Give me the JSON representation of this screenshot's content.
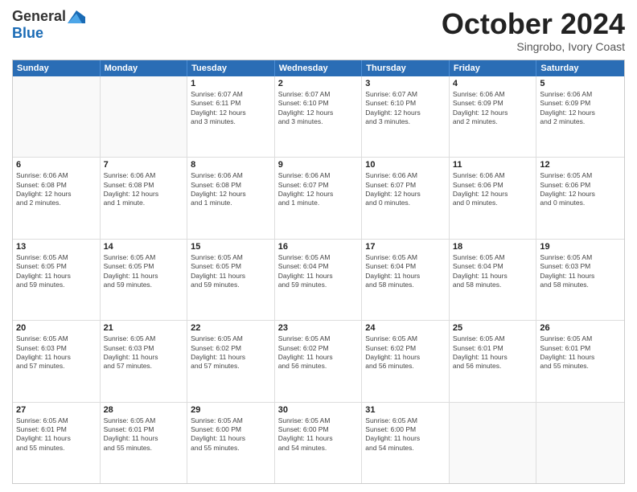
{
  "logo": {
    "general": "General",
    "blue": "Blue"
  },
  "title": "October 2024",
  "location": "Singrobo, Ivory Coast",
  "weekdays": [
    "Sunday",
    "Monday",
    "Tuesday",
    "Wednesday",
    "Thursday",
    "Friday",
    "Saturday"
  ],
  "weeks": [
    [
      {
        "day": "",
        "info": ""
      },
      {
        "day": "",
        "info": ""
      },
      {
        "day": "1",
        "info": "Sunrise: 6:07 AM\nSunset: 6:11 PM\nDaylight: 12 hours\nand 3 minutes."
      },
      {
        "day": "2",
        "info": "Sunrise: 6:07 AM\nSunset: 6:10 PM\nDaylight: 12 hours\nand 3 minutes."
      },
      {
        "day": "3",
        "info": "Sunrise: 6:07 AM\nSunset: 6:10 PM\nDaylight: 12 hours\nand 3 minutes."
      },
      {
        "day": "4",
        "info": "Sunrise: 6:06 AM\nSunset: 6:09 PM\nDaylight: 12 hours\nand 2 minutes."
      },
      {
        "day": "5",
        "info": "Sunrise: 6:06 AM\nSunset: 6:09 PM\nDaylight: 12 hours\nand 2 minutes."
      }
    ],
    [
      {
        "day": "6",
        "info": "Sunrise: 6:06 AM\nSunset: 6:08 PM\nDaylight: 12 hours\nand 2 minutes."
      },
      {
        "day": "7",
        "info": "Sunrise: 6:06 AM\nSunset: 6:08 PM\nDaylight: 12 hours\nand 1 minute."
      },
      {
        "day": "8",
        "info": "Sunrise: 6:06 AM\nSunset: 6:08 PM\nDaylight: 12 hours\nand 1 minute."
      },
      {
        "day": "9",
        "info": "Sunrise: 6:06 AM\nSunset: 6:07 PM\nDaylight: 12 hours\nand 1 minute."
      },
      {
        "day": "10",
        "info": "Sunrise: 6:06 AM\nSunset: 6:07 PM\nDaylight: 12 hours\nand 0 minutes."
      },
      {
        "day": "11",
        "info": "Sunrise: 6:06 AM\nSunset: 6:06 PM\nDaylight: 12 hours\nand 0 minutes."
      },
      {
        "day": "12",
        "info": "Sunrise: 6:05 AM\nSunset: 6:06 PM\nDaylight: 12 hours\nand 0 minutes."
      }
    ],
    [
      {
        "day": "13",
        "info": "Sunrise: 6:05 AM\nSunset: 6:05 PM\nDaylight: 11 hours\nand 59 minutes."
      },
      {
        "day": "14",
        "info": "Sunrise: 6:05 AM\nSunset: 6:05 PM\nDaylight: 11 hours\nand 59 minutes."
      },
      {
        "day": "15",
        "info": "Sunrise: 6:05 AM\nSunset: 6:05 PM\nDaylight: 11 hours\nand 59 minutes."
      },
      {
        "day": "16",
        "info": "Sunrise: 6:05 AM\nSunset: 6:04 PM\nDaylight: 11 hours\nand 59 minutes."
      },
      {
        "day": "17",
        "info": "Sunrise: 6:05 AM\nSunset: 6:04 PM\nDaylight: 11 hours\nand 58 minutes."
      },
      {
        "day": "18",
        "info": "Sunrise: 6:05 AM\nSunset: 6:04 PM\nDaylight: 11 hours\nand 58 minutes."
      },
      {
        "day": "19",
        "info": "Sunrise: 6:05 AM\nSunset: 6:03 PM\nDaylight: 11 hours\nand 58 minutes."
      }
    ],
    [
      {
        "day": "20",
        "info": "Sunrise: 6:05 AM\nSunset: 6:03 PM\nDaylight: 11 hours\nand 57 minutes."
      },
      {
        "day": "21",
        "info": "Sunrise: 6:05 AM\nSunset: 6:03 PM\nDaylight: 11 hours\nand 57 minutes."
      },
      {
        "day": "22",
        "info": "Sunrise: 6:05 AM\nSunset: 6:02 PM\nDaylight: 11 hours\nand 57 minutes."
      },
      {
        "day": "23",
        "info": "Sunrise: 6:05 AM\nSunset: 6:02 PM\nDaylight: 11 hours\nand 56 minutes."
      },
      {
        "day": "24",
        "info": "Sunrise: 6:05 AM\nSunset: 6:02 PM\nDaylight: 11 hours\nand 56 minutes."
      },
      {
        "day": "25",
        "info": "Sunrise: 6:05 AM\nSunset: 6:01 PM\nDaylight: 11 hours\nand 56 minutes."
      },
      {
        "day": "26",
        "info": "Sunrise: 6:05 AM\nSunset: 6:01 PM\nDaylight: 11 hours\nand 55 minutes."
      }
    ],
    [
      {
        "day": "27",
        "info": "Sunrise: 6:05 AM\nSunset: 6:01 PM\nDaylight: 11 hours\nand 55 minutes."
      },
      {
        "day": "28",
        "info": "Sunrise: 6:05 AM\nSunset: 6:01 PM\nDaylight: 11 hours\nand 55 minutes."
      },
      {
        "day": "29",
        "info": "Sunrise: 6:05 AM\nSunset: 6:00 PM\nDaylight: 11 hours\nand 55 minutes."
      },
      {
        "day": "30",
        "info": "Sunrise: 6:05 AM\nSunset: 6:00 PM\nDaylight: 11 hours\nand 54 minutes."
      },
      {
        "day": "31",
        "info": "Sunrise: 6:05 AM\nSunset: 6:00 PM\nDaylight: 11 hours\nand 54 minutes."
      },
      {
        "day": "",
        "info": ""
      },
      {
        "day": "",
        "info": ""
      }
    ]
  ]
}
